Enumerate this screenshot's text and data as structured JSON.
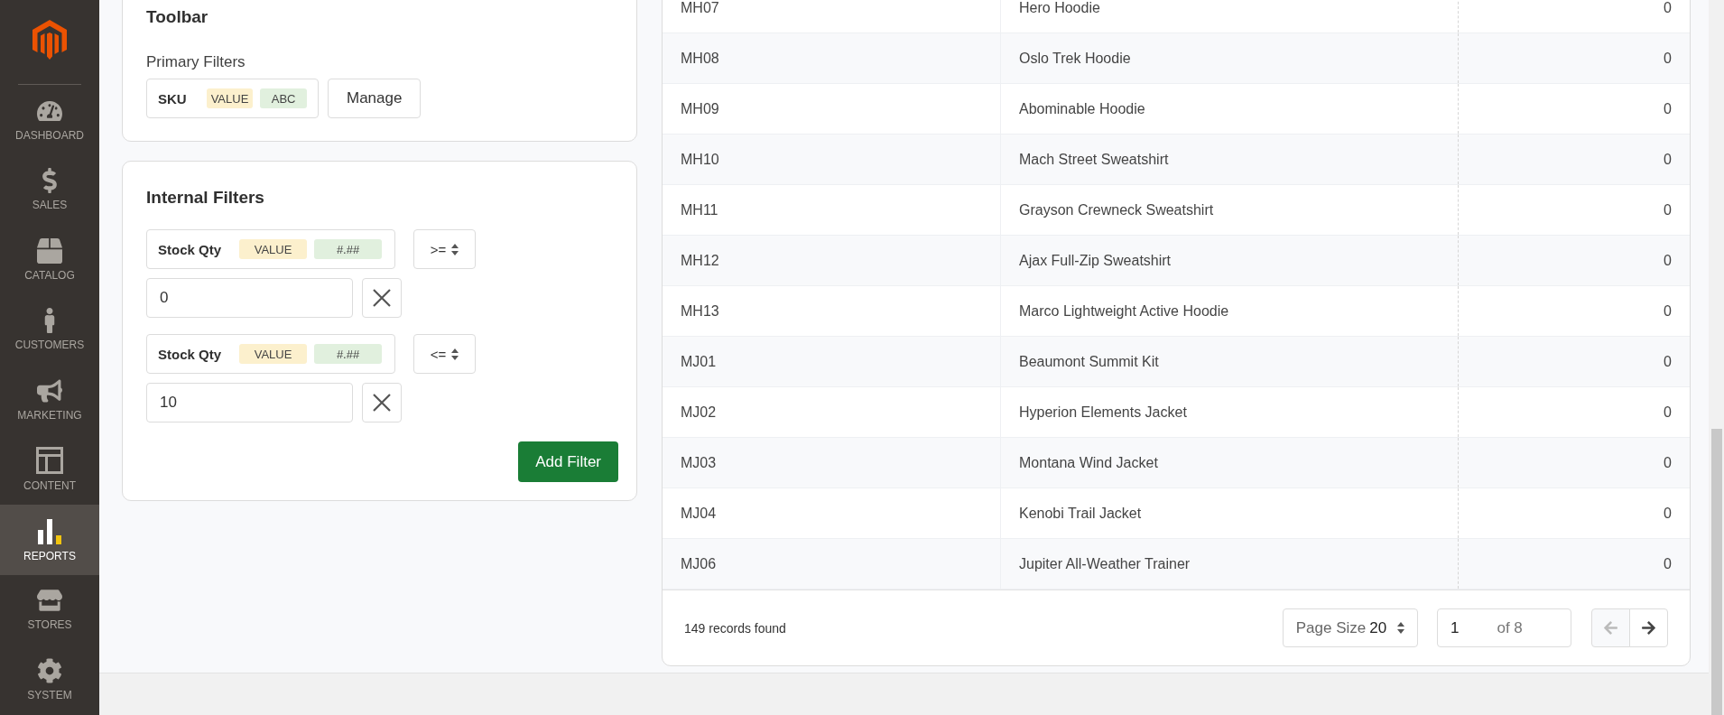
{
  "sidebar": {
    "items": [
      {
        "label": "DASHBOARD",
        "selected": false
      },
      {
        "label": "SALES",
        "selected": false
      },
      {
        "label": "CATALOG",
        "selected": false
      },
      {
        "label": "CUSTOMERS",
        "selected": false
      },
      {
        "label": "MARKETING",
        "selected": false
      },
      {
        "label": "CONTENT",
        "selected": false
      },
      {
        "label": "REPORTS",
        "selected": true
      },
      {
        "label": "STORES",
        "selected": false
      },
      {
        "label": "SYSTEM",
        "selected": false
      }
    ]
  },
  "toolbar": {
    "title": "Toolbar",
    "primary_filters_label": "Primary Filters",
    "primary_filter": {
      "field": "SKU",
      "tags": [
        "VALUE",
        "ABC"
      ]
    },
    "manage_button": "Manage"
  },
  "internal_filters": {
    "title": "Internal Filters",
    "filters": [
      {
        "field": "Stock Qty",
        "tags": [
          "VALUE",
          "#.##"
        ],
        "operator": ">=",
        "value": "0"
      },
      {
        "field": "Stock Qty",
        "tags": [
          "VALUE",
          "#.##"
        ],
        "operator": "<=",
        "value": "10"
      }
    ],
    "add_button": "Add Filter"
  },
  "table": {
    "rows": [
      [
        "MH07",
        "Hero Hoodie",
        "0"
      ],
      [
        "MH08",
        "Oslo Trek Hoodie",
        "0"
      ],
      [
        "MH09",
        "Abominable Hoodie",
        "0"
      ],
      [
        "MH10",
        "Mach Street Sweatshirt",
        "0"
      ],
      [
        "MH11",
        "Grayson Crewneck Sweatshirt",
        "0"
      ],
      [
        "MH12",
        "Ajax Full-Zip Sweatshirt",
        "0"
      ],
      [
        "MH13",
        "Marco Lightweight Active Hoodie",
        "0"
      ],
      [
        "MJ01",
        "Beaumont Summit Kit",
        "0"
      ],
      [
        "MJ02",
        "Hyperion Elements Jacket",
        "0"
      ],
      [
        "MJ03",
        "Montana Wind Jacket",
        "0"
      ],
      [
        "MJ04",
        "Kenobi Trail Jacket",
        "0"
      ],
      [
        "MJ06",
        "Jupiter All-Weather Trainer",
        "0"
      ]
    ],
    "records": "149 records found",
    "pagination": {
      "page_size_label": "Page Size",
      "page_size": "20",
      "page": "1",
      "of_pages": "of 8",
      "prev_disabled": true,
      "next_disabled": false
    }
  }
}
